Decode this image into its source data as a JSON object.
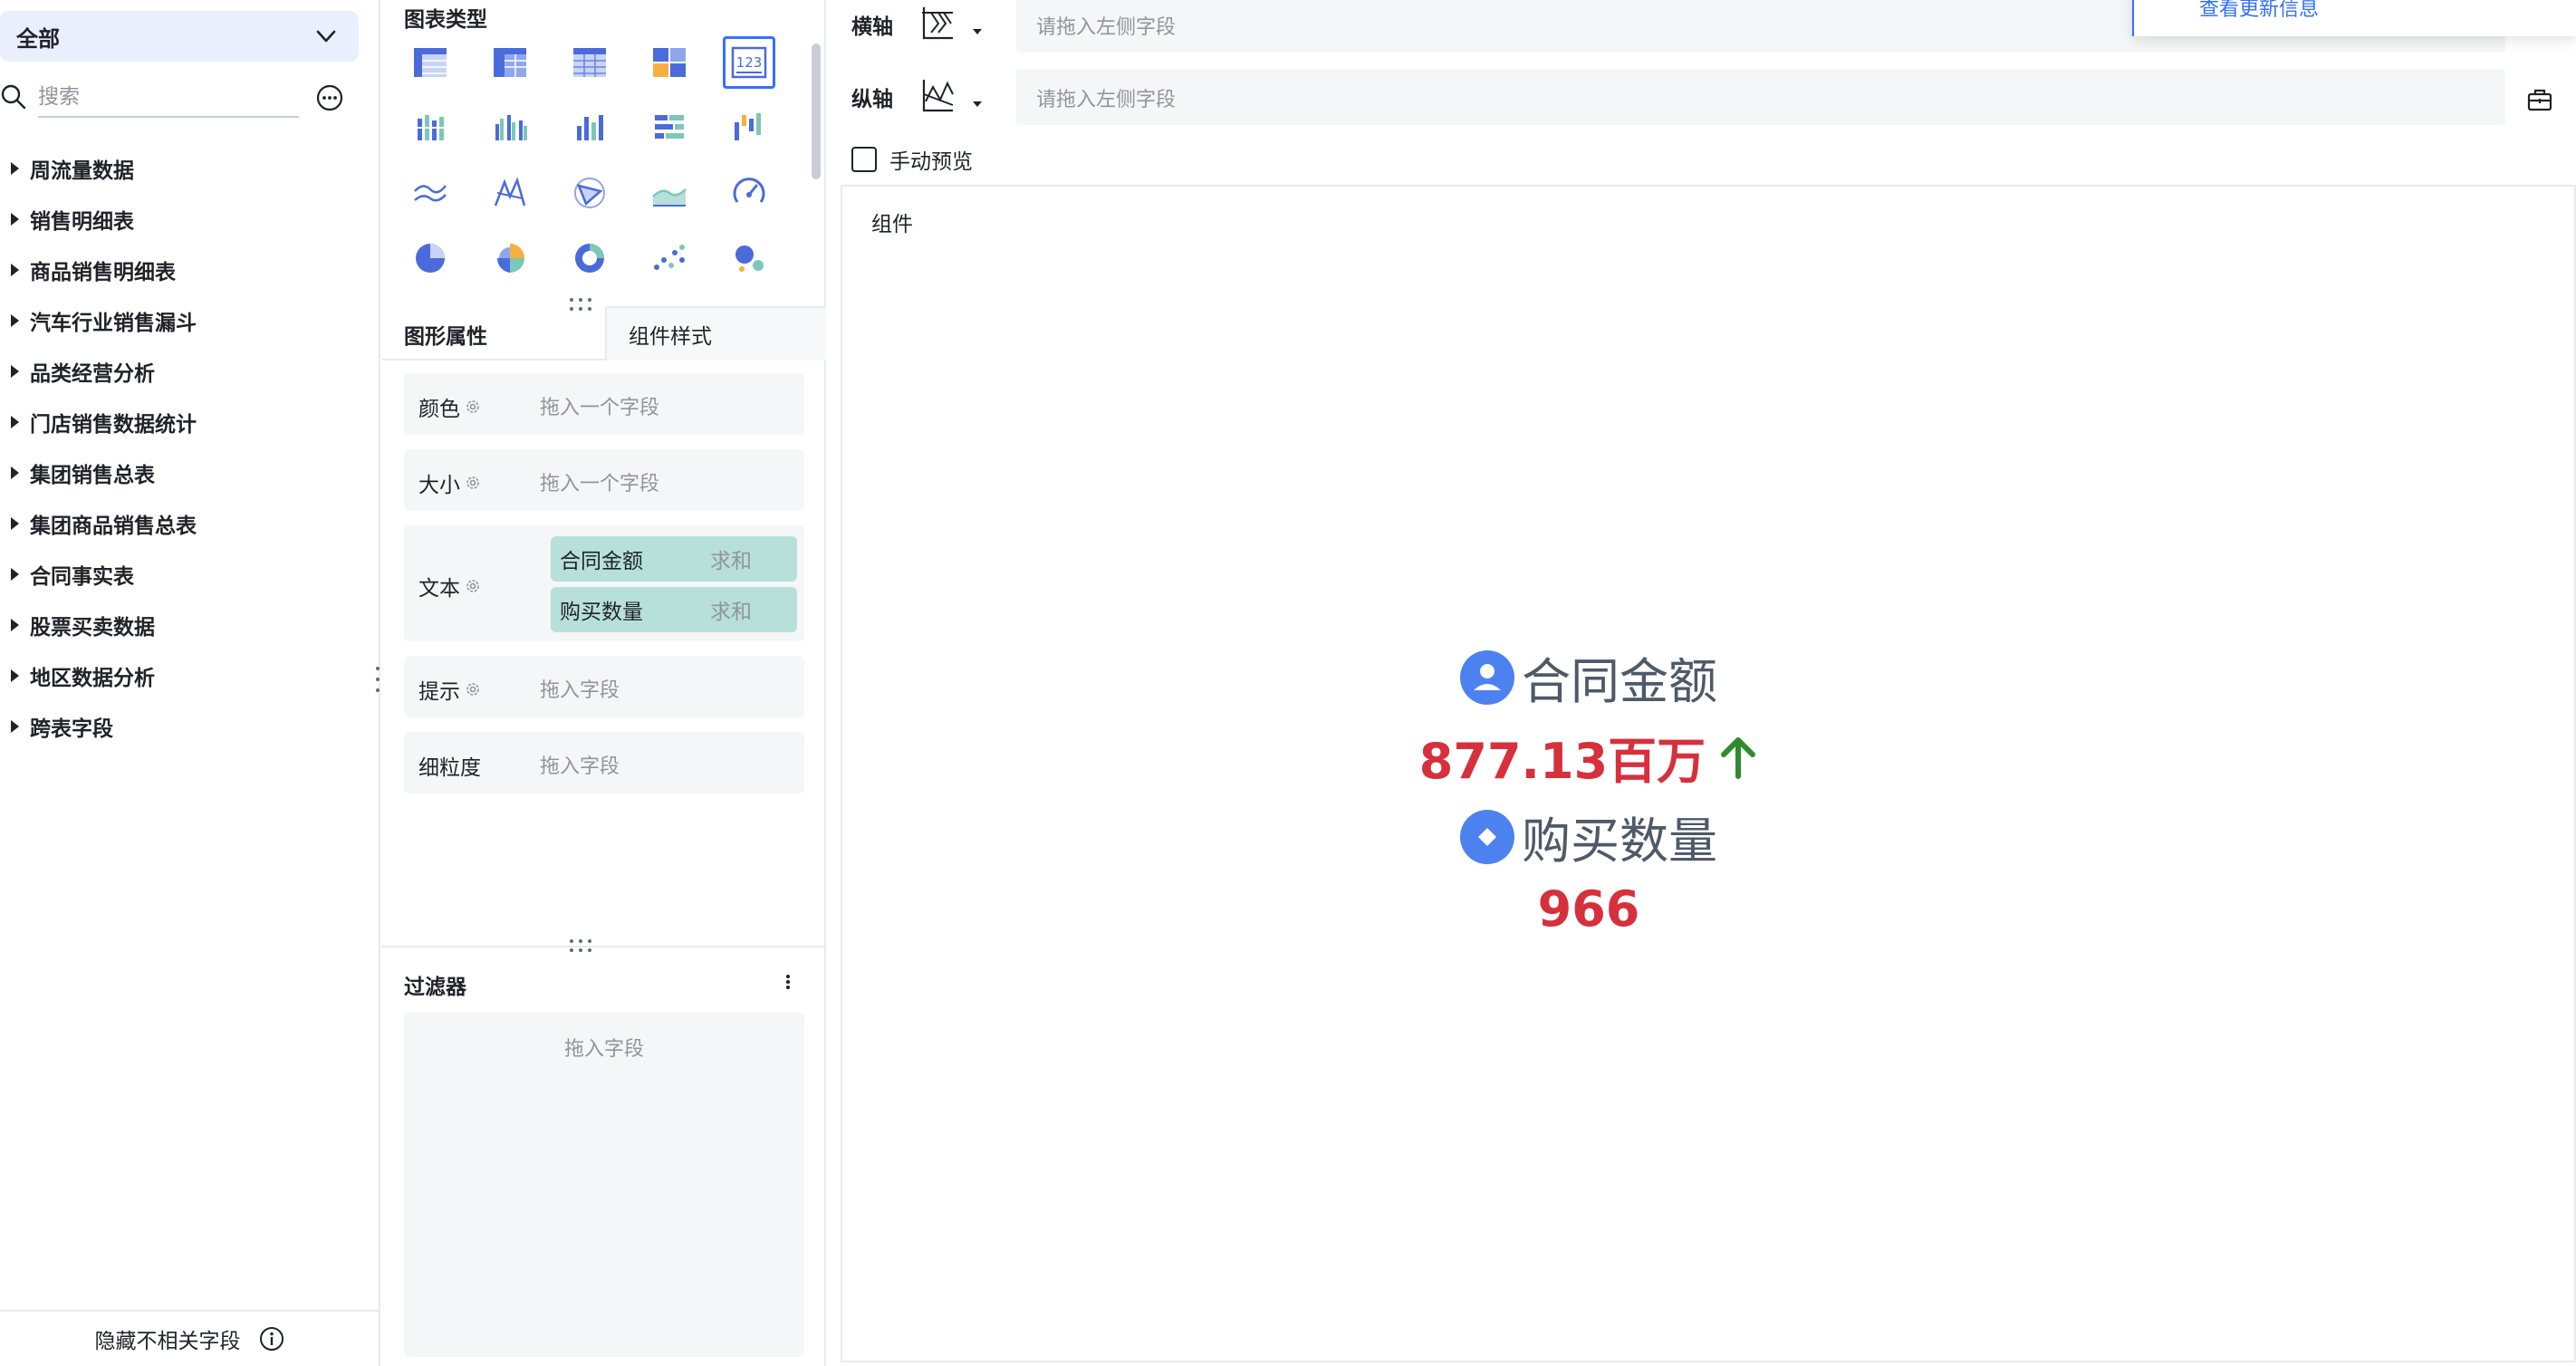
{
  "left_panel": {
    "dataset_select": "全部",
    "search_placeholder": "搜索",
    "tree_items": [
      "周流量数据",
      "销售明细表",
      "商品销售明细表",
      "汽车行业销售漏斗",
      "品类经营分析",
      "门店销售数据统计",
      "集团销售总表",
      "集团商品销售总表",
      "合同事实表",
      "股票买卖数据",
      "地区数据分析",
      "跨表字段"
    ],
    "hide_irrelevant": "隐藏不相关字段"
  },
  "config_panel": {
    "chart_type_title": "图表类型",
    "selected_chart_type": "indicator-card",
    "tabs": {
      "attributes": "图形属性",
      "style": "组件样式"
    },
    "slots": {
      "color": {
        "label": "颜色",
        "placeholder": "拖入一个字段"
      },
      "size": {
        "label": "大小",
        "placeholder": "拖入一个字段"
      },
      "text": {
        "label": "文本",
        "fields": [
          {
            "name": "合同金额",
            "agg": "求和"
          },
          {
            "name": "购买数量",
            "agg": "求和"
          }
        ]
      },
      "tooltip": {
        "label": "提示",
        "placeholder": "拖入字段"
      },
      "granularity": {
        "label": "细粒度",
        "placeholder": "拖入字段"
      }
    },
    "filter": {
      "title": "过滤器",
      "placeholder": "拖入字段"
    }
  },
  "canvas": {
    "x_axis": {
      "label": "横轴",
      "placeholder": "请拖入左侧字段"
    },
    "y_axis": {
      "label": "纵轴",
      "placeholder": "请拖入左侧字段"
    },
    "popover_text": "查看更新信息",
    "manual_preview": "手动预览",
    "component_label": "组件",
    "kpi": [
      {
        "title": "合同金额",
        "value": "877.13百万",
        "trend": "up",
        "icon": "user-circle-icon"
      },
      {
        "title": "购买数量",
        "value": "966",
        "icon": "diamond-circle-icon"
      }
    ]
  },
  "colors": {
    "accent": "#3370ff",
    "kpi_value": "#d6303d",
    "trend_up": "#2e8b2e",
    "pill_bg": "#b8e0da",
    "select_bg": "#e9effd"
  }
}
